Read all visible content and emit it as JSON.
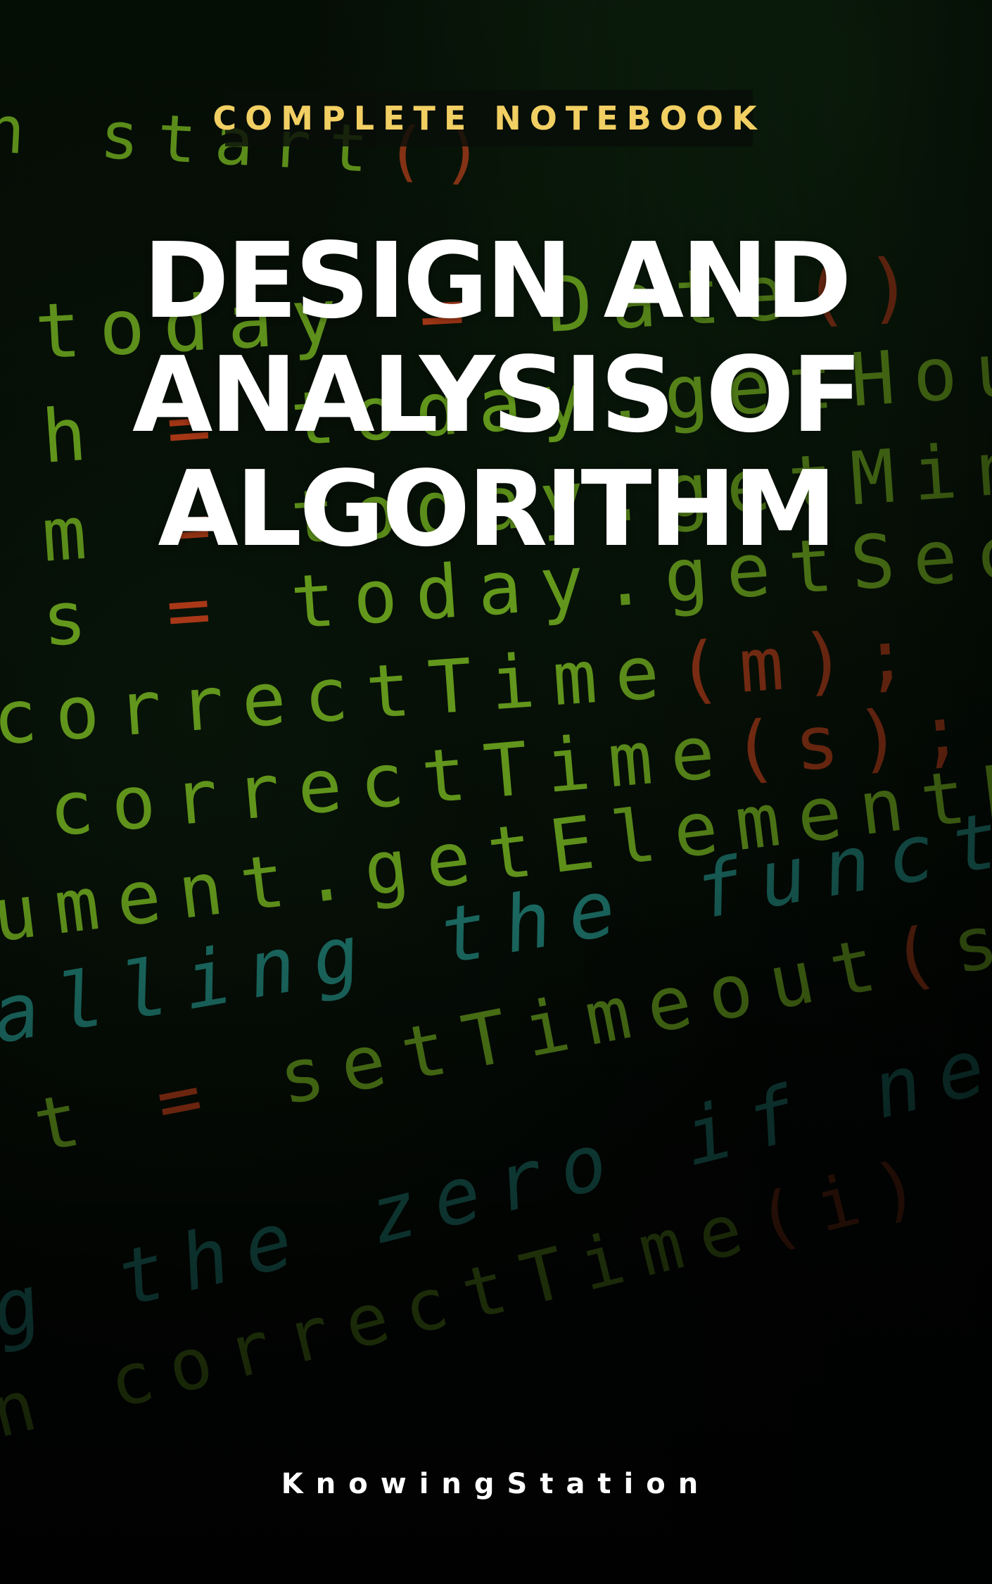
{
  "cover": {
    "series_label": "COMPLETE NOTEBOOK",
    "title_lines": [
      "DESIGN AND",
      "ANALYSIS OF",
      "ALGORITHM"
    ],
    "publisher": "KnowingStation"
  },
  "colors": {
    "series_label": "#f2cf63",
    "title": "#ffffff",
    "publisher": "#ffffff",
    "code_green": "#7fc324",
    "code_operator": "#d9481e",
    "code_comment": "#2aa69a",
    "background": "#030503"
  }
}
